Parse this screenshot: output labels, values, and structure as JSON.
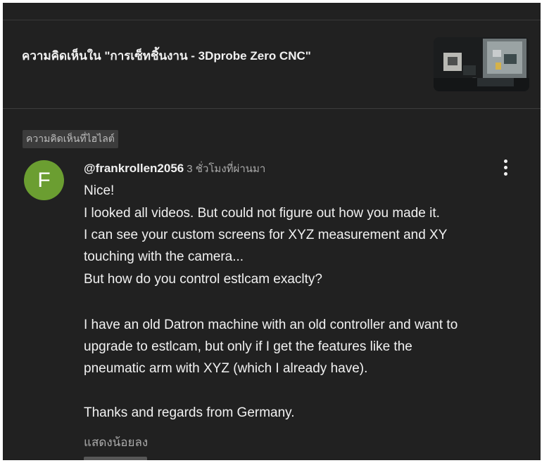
{
  "header": {
    "title": "ความคิดเห็นใน \"การเซ็ทชิ้นงาน - 3Dprobe Zero CNC\""
  },
  "highlight_chip": "ความคิดเห็นที่ไฮไลต์",
  "comment": {
    "avatar_letter": "F",
    "avatar_color": "#6b9e31",
    "author": "@frankrollen2056",
    "time": "3 ชั่วโมงที่ผ่านมา",
    "lines": [
      "Nice!",
      "I looked all videos. But could not figure out how you made it.",
      "I can see your custom screens for XYZ measurement and XY",
      "touching with the camera...",
      "But how do you control estlcam exaclty?",
      "I have an old Datron machine with an old controller and want to",
      "upgrade to estlcam, but only if I get the features like the",
      "pneumatic arm with XYZ (which I already have).",
      "Thanks and regards from Germany."
    ],
    "show_less": "แสดงน้อยลง"
  },
  "icons": {
    "more": "more-vert-icon"
  },
  "colors": {
    "background": "#212121",
    "text": "#f1f1f1",
    "secondary": "#aaaaaa"
  }
}
